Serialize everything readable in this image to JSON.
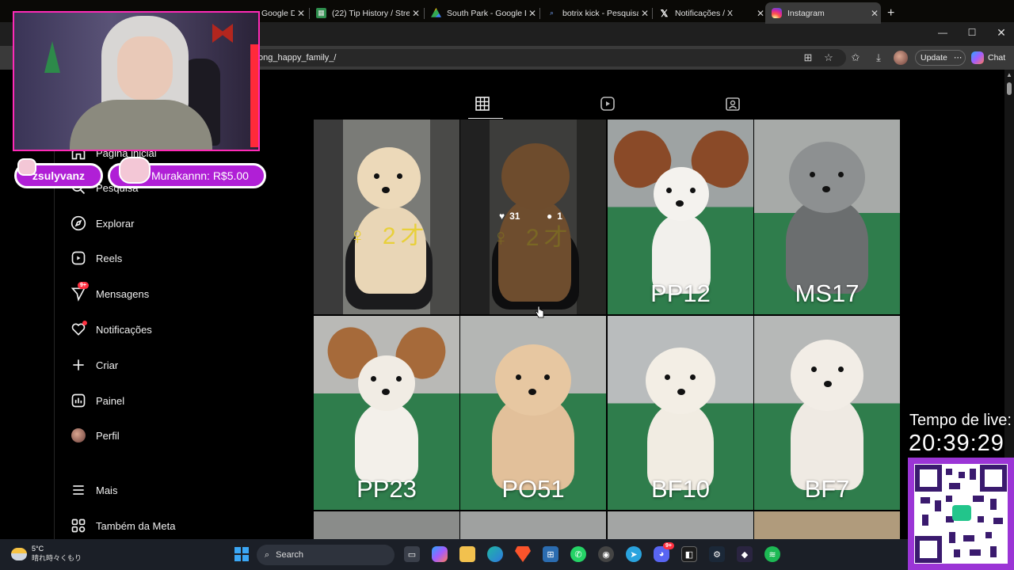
{
  "browser": {
    "tabs": [
      {
        "title": "Google D",
        "active": false
      },
      {
        "title": "(22) Tip History / Stre",
        "active": false
      },
      {
        "title": "South Park - Google D",
        "active": false
      },
      {
        "title": "botrix kick - Pesquisar",
        "active": false
      },
      {
        "title": "Notificações / X",
        "active": false
      },
      {
        "title": "Instagram",
        "active": true
      }
    ],
    "new_tab": "+",
    "url": "ong_happy_family_/",
    "update_label": "Update",
    "chat_label": "Chat"
  },
  "sidebar": {
    "items": [
      {
        "label": "Página inicial",
        "icon": "home-icon"
      },
      {
        "label": "Pesquisa",
        "icon": "search-icon"
      },
      {
        "label": "Explorar",
        "icon": "compass-icon"
      },
      {
        "label": "Reels",
        "icon": "reels-icon"
      },
      {
        "label": "Mensagens",
        "icon": "messenger-icon",
        "badge": "9+"
      },
      {
        "label": "Notificações",
        "icon": "heart-icon"
      },
      {
        "label": "Criar",
        "icon": "plus-icon"
      },
      {
        "label": "Painel",
        "icon": "dashboard-icon"
      },
      {
        "label": "Perfil",
        "icon": "avatar"
      },
      {
        "label": "Mais",
        "icon": "menu-icon"
      },
      {
        "label": "Também da Meta",
        "icon": "meta-icon"
      }
    ]
  },
  "profile_tabs": [
    "posts-grid-icon",
    "reels-tab-icon",
    "tagged-icon"
  ],
  "grid": {
    "posts": [
      {
        "label": "♀ 2才",
        "style": "symbol"
      },
      {
        "label": "♀ 2才",
        "style": "symbol",
        "hover": true,
        "likes": "31",
        "comments": "1"
      },
      {
        "label": "PP12"
      },
      {
        "label": "MS17"
      },
      {
        "label": "PP23"
      },
      {
        "label": "PO51"
      },
      {
        "label": "BF10"
      },
      {
        "label": "BF7"
      }
    ]
  },
  "stream_overlay": {
    "chatter": "zsulyvanz",
    "tip_text": "Murakannn: R$5.00",
    "live_label": "Tempo de live:",
    "live_time": "20:39:29"
  },
  "taskbar": {
    "temperature": "5°C",
    "forecast": "晴れ時々くもり",
    "search_label": "Search",
    "chat_badge": "9+"
  },
  "colors": {
    "accent_pink": "#ff2ab7",
    "overlay_purple": "#b01fd6",
    "notification_red": "#ff3040",
    "mat_green": "#2e7d4a"
  }
}
